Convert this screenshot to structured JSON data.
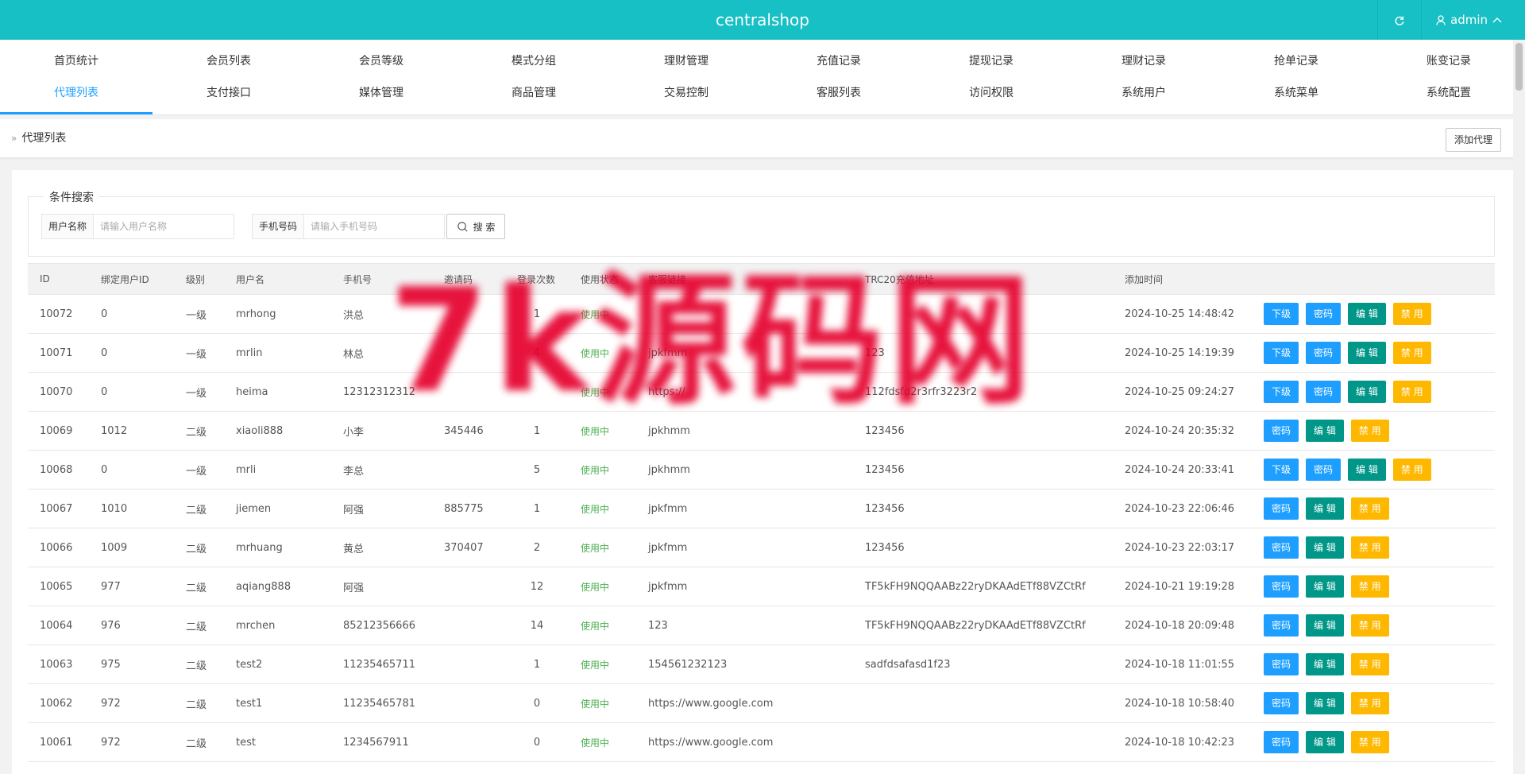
{
  "app": {
    "title": "centralshop",
    "user": "admin"
  },
  "nav": {
    "row1": [
      "首页统计",
      "会员列表",
      "会员等级",
      "模式分组",
      "理财管理",
      "充值记录",
      "提现记录",
      "理财记录",
      "抢单记录",
      "账变记录"
    ],
    "row2": [
      "代理列表",
      "支付接口",
      "媒体管理",
      "商品管理",
      "交易控制",
      "客服列表",
      "访问权限",
      "系统用户",
      "系统菜单",
      "系统配置"
    ],
    "active": "代理列表"
  },
  "breadcrumb": {
    "title": "代理列表",
    "add_label": "添加代理"
  },
  "search": {
    "legend": "条件搜索",
    "username_label": "用户名称",
    "username_placeholder": "请输入用户名称",
    "phone_label": "手机号码",
    "phone_placeholder": "请输入手机号码",
    "button_label": "搜 索"
  },
  "table": {
    "columns": [
      "ID",
      "绑定用户ID",
      "级别",
      "用户名",
      "手机号",
      "邀请码",
      "登录次数",
      "使用状态",
      "客服链接",
      "TRC20充值地址",
      "添加时间",
      ""
    ],
    "buttons": {
      "sub": "下级",
      "password": "密码",
      "edit": "编 辑",
      "disable": "禁 用"
    },
    "rows": [
      {
        "id": "10072",
        "uid": "0",
        "level": "一级",
        "username": "mrhong",
        "phone": "洪总",
        "code": "",
        "logins": "1",
        "status": "使用中",
        "link": "",
        "trc": "",
        "time": "2024-10-25 14:48:42",
        "sub": true
      },
      {
        "id": "10071",
        "uid": "0",
        "level": "一级",
        "username": "mrlin",
        "phone": "林总",
        "code": "",
        "logins": "4",
        "status": "使用中",
        "link": "jpkfmm",
        "trc": "123",
        "time": "2024-10-25 14:19:39",
        "sub": true
      },
      {
        "id": "10070",
        "uid": "0",
        "level": "一级",
        "username": "heima",
        "phone": "12312312312",
        "code": "",
        "logins": "",
        "status": "使用中",
        "link": "https://",
        "trc": "112fdsfd2r3rfr3223r2",
        "time": "2024-10-25 09:24:27",
        "sub": true
      },
      {
        "id": "10069",
        "uid": "1012",
        "level": "二级",
        "username": "xiaoli888",
        "phone": "小李",
        "code": "345446",
        "logins": "1",
        "status": "使用中",
        "link": "jpkhmm",
        "trc": "123456",
        "time": "2024-10-24 20:35:32",
        "sub": false
      },
      {
        "id": "10068",
        "uid": "0",
        "level": "一级",
        "username": "mrli",
        "phone": "李总",
        "code": "",
        "logins": "5",
        "status": "使用中",
        "link": "jpkhmm",
        "trc": "123456",
        "time": "2024-10-24 20:33:41",
        "sub": true
      },
      {
        "id": "10067",
        "uid": "1010",
        "level": "二级",
        "username": "jiemen",
        "phone": "阿强",
        "code": "885775",
        "logins": "1",
        "status": "使用中",
        "link": "jpkfmm",
        "trc": "123456",
        "time": "2024-10-23 22:06:46",
        "sub": false
      },
      {
        "id": "10066",
        "uid": "1009",
        "level": "二级",
        "username": "mrhuang",
        "phone": "黄总",
        "code": "370407",
        "logins": "2",
        "status": "使用中",
        "link": "jpkfmm",
        "trc": "123456",
        "time": "2024-10-23 22:03:17",
        "sub": false
      },
      {
        "id": "10065",
        "uid": "977",
        "level": "二级",
        "username": "aqiang888",
        "phone": "阿强",
        "code": "",
        "logins": "12",
        "status": "使用中",
        "link": "jpkfmm",
        "trc": "TF5kFH9NQQAABz22ryDKAAdETf88VZCtRf",
        "time": "2024-10-21 19:19:28",
        "sub": false
      },
      {
        "id": "10064",
        "uid": "976",
        "level": "二级",
        "username": "mrchen",
        "phone": "85212356666",
        "code": "",
        "logins": "14",
        "status": "使用中",
        "link": "123",
        "trc": "TF5kFH9NQQAABz22ryDKAAdETf88VZCtRf",
        "time": "2024-10-18 20:09:48",
        "sub": false
      },
      {
        "id": "10063",
        "uid": "975",
        "level": "二级",
        "username": "test2",
        "phone": "11235465711",
        "code": "",
        "logins": "1",
        "status": "使用中",
        "link": "154561232123",
        "trc": "sadfdsafasd1f23",
        "time": "2024-10-18 11:01:55",
        "sub": false
      },
      {
        "id": "10062",
        "uid": "972",
        "level": "二级",
        "username": "test1",
        "phone": "11235465781",
        "code": "",
        "logins": "0",
        "status": "使用中",
        "link": "https://www.google.com",
        "trc": "",
        "time": "2024-10-18 10:58:40",
        "sub": false
      },
      {
        "id": "10061",
        "uid": "972",
        "level": "二级",
        "username": "test",
        "phone": "1234567911",
        "code": "",
        "logins": "0",
        "status": "使用中",
        "link": "https://www.google.com",
        "trc": "",
        "time": "2024-10-18 10:42:23",
        "sub": false
      }
    ]
  },
  "watermark": "7k源码网"
}
